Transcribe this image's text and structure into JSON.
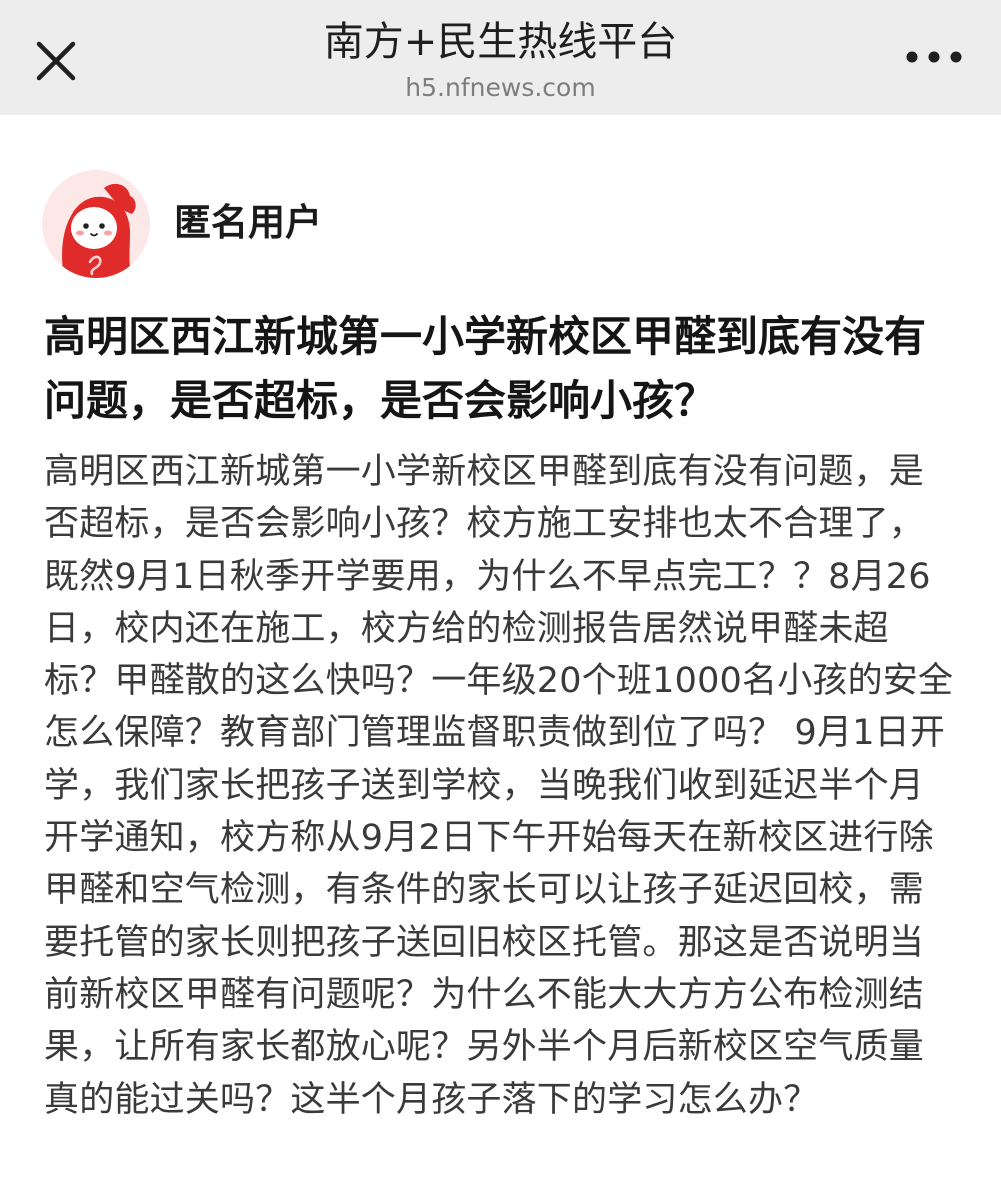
{
  "header": {
    "title": "南方+民生热线平台",
    "url": "h5.nfnews.com",
    "close_icon": "close-icon",
    "more_icon": "more-horizontal-icon"
  },
  "post": {
    "author": "匿名用户",
    "avatar_icon": "mascot-avatar",
    "title": "高明区西江新城第一小学新校区甲醛到底有没有问题，是否超标，是否会影响小孩？",
    "body": "高明区西江新城第一小学新校区甲醛到底有没有问题，是否超标，是否会影响小孩？校方施工安排也太不合理了，既然9月1日秋季开学要用，为什么不早点完工？？8月26日，校内还在施工，校方给的检测报告居然说甲醛未超标？甲醛散的这么快吗？一年级20个班1000名小孩的安全怎么保障？教育部门管理监督职责做到位了吗？ 9月1日开学，我们家长把孩子送到学校，当晚我们收到延迟半个月开学通知，校方称从9月2日下午开始每天在新校区进行除甲醛和空气检测，有条件的家长可以让孩子延迟回校，需要托管的家长则把孩子送回旧校区托管。那这是否说明当前新校区甲醛有问题呢？为什么不能大大方方公布检测结果，让所有家长都放心呢？另外半个月后新校区空气质量真的能过关吗？这半个月孩子落下的学习怎么办？"
  },
  "colors": {
    "topbar_bg": "#ededed",
    "avatar_bg": "#fde8e8",
    "mascot_red": "#e02b2b",
    "title_text": "#151515",
    "body_text": "#3a3a3a"
  }
}
